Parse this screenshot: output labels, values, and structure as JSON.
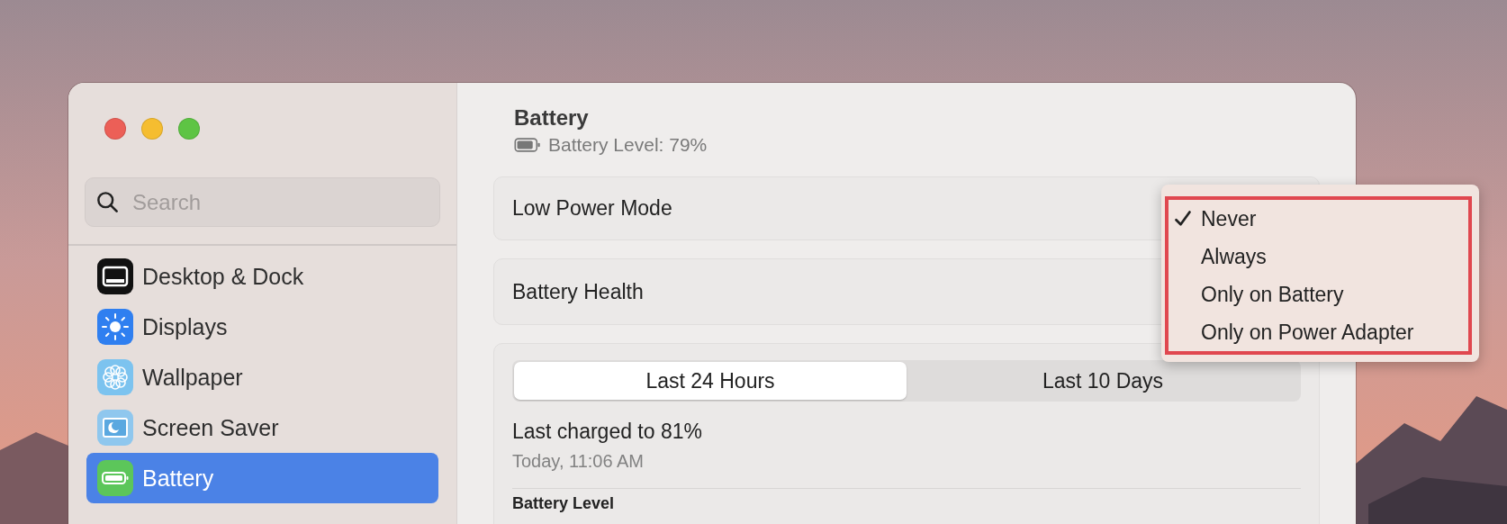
{
  "sidebar": {
    "search": {
      "placeholder": "Search"
    },
    "items": [
      {
        "label": "Desktop & Dock",
        "kind": "dock",
        "selected": false
      },
      {
        "label": "Displays",
        "kind": "displays",
        "selected": false
      },
      {
        "label": "Wallpaper",
        "kind": "wallpaper",
        "selected": false
      },
      {
        "label": "Screen Saver",
        "kind": "screensaver",
        "selected": false
      },
      {
        "label": "Battery",
        "kind": "battery",
        "selected": true
      }
    ]
  },
  "header": {
    "title": "Battery",
    "subtitle": "Battery Level: 79%"
  },
  "settings": [
    {
      "label": "Low Power Mode"
    },
    {
      "label": "Battery Health"
    }
  ],
  "usage": {
    "segments": [
      {
        "label": "Last 24 Hours",
        "selected": true
      },
      {
        "label": "Last 10 Days",
        "selected": false
      }
    ],
    "last_charged": "Last charged to 81%",
    "time": "Today, 11:06 AM",
    "section_title": "Battery Level"
  },
  "dropdown": {
    "highlighted": true,
    "items": [
      {
        "label": "Never",
        "selected": true
      },
      {
        "label": "Always",
        "selected": false
      },
      {
        "label": "Only on Battery",
        "selected": false
      },
      {
        "label": "Only on Power Adapter",
        "selected": false
      }
    ]
  }
}
